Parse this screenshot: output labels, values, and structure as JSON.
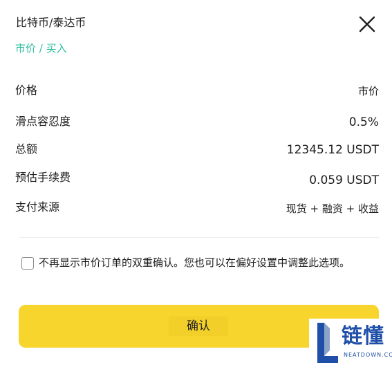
{
  "header": {
    "title": "比特币/泰达币",
    "subtitle": "市价 / 买入"
  },
  "details": [
    {
      "label": "价格",
      "value": "市价"
    },
    {
      "label": "滑点容忍度",
      "value": "0.5%"
    },
    {
      "label": "总额",
      "value": "12345.12 USDT"
    },
    {
      "label": "预估手续费",
      "value": "0.059 USDT"
    },
    {
      "label": "支付来源",
      "value": "现货 + 融资 + 收益"
    }
  ],
  "confirm_option": {
    "checked": false,
    "label": "不再显示市价订单的双重确认。您也可以在偏好设置中调整此选项。"
  },
  "confirm_button": {
    "label": "确认"
  },
  "watermark": {
    "brand": "链懂",
    "domain": "NEATDOWN.COM"
  },
  "colors": {
    "accent_green": "#2fbf9f",
    "button_yellow": "#f7d52c",
    "watermark_blue": "#1f4fa8"
  },
  "icons": {
    "close": "close-icon",
    "checkbox": "checkbox-unchecked-icon"
  }
}
